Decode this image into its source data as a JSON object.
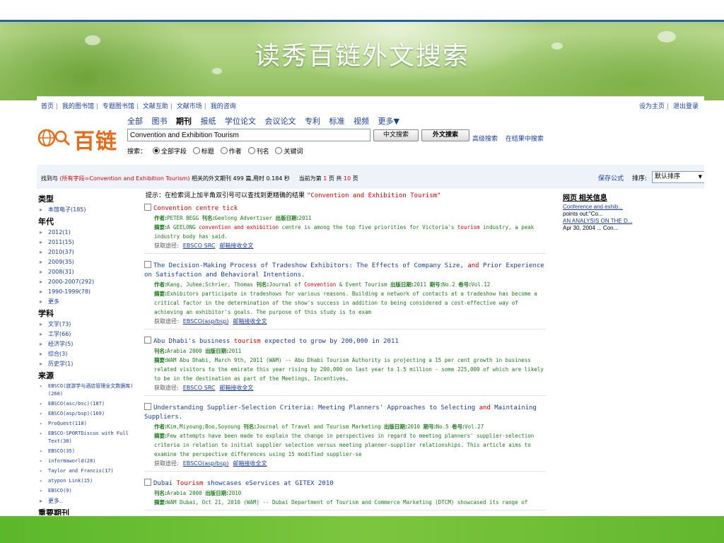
{
  "slide_title": "读秀百链外文搜索",
  "nav": {
    "links": [
      "首页",
      "我的图书馆",
      "专题图书馆",
      "文献互助",
      "文献市场",
      "我的咨询"
    ],
    "right_links": [
      "设为主页",
      "退出登录"
    ]
  },
  "logo_text": "百链",
  "categories": [
    "全部",
    "图书",
    "期刊",
    "报纸",
    "学位论文",
    "会议论文",
    "专利",
    "标准",
    "视频",
    "更多▼"
  ],
  "active_category": "期刊",
  "search": {
    "value": "Convention and Exhibition Tourism",
    "btn_chinese": "中文搜索",
    "btn_foreign": "外文搜索",
    "advanced": "高级搜索",
    "within": "在结果中搜索"
  },
  "scope": {
    "label": "搜索：",
    "options": [
      "全部字段",
      "标题",
      "作者",
      "刊名",
      "关键词"
    ],
    "selected": "全部字段"
  },
  "summary": {
    "prefix": "找到与",
    "query_text": "(所有字段=Convention and Exhibition Tourism)",
    "mid": "相关的外文期刊",
    "count": "499",
    "unit": "篇,用时",
    "time": "0.184",
    "time_unit": "秒",
    "page_label": "当前为第",
    "page": "1",
    "page_mid": "页 共",
    "pages": "10",
    "page_suffix": "页",
    "save_formula": "保存公式",
    "sort_label": "排序:",
    "sort_value": "默认排序"
  },
  "sidebar": {
    "type_header": "类型",
    "types": [
      "本馆电子(185)"
    ],
    "year_header": "年代",
    "years": [
      "2012(1)",
      "2011(15)",
      "2010(37)",
      "2009(35)",
      "2008(31)",
      "2000-2007(292)",
      "1990-1999(78)",
      "更多"
    ],
    "subject_header": "学科",
    "subjects": [
      "文学(73)",
      "工学(66)",
      "经济学(5)",
      "综合(3)",
      "历史学(1)"
    ],
    "source_header": "来源",
    "sources": [
      "EBSCO(旅游学与酒店管理全文数据库)(260)",
      "EBSCO(asc/bsc)(187)",
      "EBSCO(asp/bsp)(169)",
      "ProQuest(110)",
      "EBSCO-SPORTDiscus with Full Text(38)",
      "EBSCO(35)",
      "informaworld(28)",
      "Taylor and Francis(17)",
      "atypon Link(15)",
      "EBSCO(9)",
      "更多.."
    ],
    "journal_header": "重要期刊"
  },
  "hint": {
    "text": "提示：在检索词上加半角双引号可以查找到更精确的结果",
    "query": "\"Convention and Exhibition Tourism\""
  },
  "labels": {
    "author": "作者:",
    "journal": "刊名:",
    "date": "出版日期:",
    "issue": "期号:",
    "volume": "卷号:",
    "abstract": "摘要:",
    "access": "获取途径:",
    "email_delivery": "邮箱接收全文"
  },
  "results": [
    {
      "title": "Convention centre tick",
      "author": "PETER BEGG",
      "journal": "Geelong Advertiser",
      "date": "2011",
      "abstract_pre": "A GEELONG ",
      "abstract_hl1": "convention and exhibition",
      "abstract_mid": " centre is among the top five priorities for Victoria's ",
      "abstract_hl2": "tourism",
      "abstract_post": " industry, a peak industry body has said.",
      "source": "EBSCO SRC"
    },
    {
      "title_pre": "The Decision-Making Process of Tradeshow Exhibitors: The Effects of Company Size, ",
      "title_hl": "and",
      "title_post": " Prior Experience on Satisfaction and Behavioral Intentions.",
      "author": "Kang, Juhee;Schrier, Thomas",
      "journal_pre": "Journal of ",
      "journal_hl": "Convention",
      "journal_post": " & Event Tourism",
      "date": "2011",
      "issue": "No.2",
      "volume": "Vol.12",
      "abstract": "Exhibitors participate in tradeshows for various reasons. Building a network of contacts at a tradeshow has become a critical factor in the determination of the show's success in addition to being considered a cost-effective way of achieving an exhibitor's goals. The purpose of this study is to exam",
      "source": "EBSCO(asp/bsp)"
    },
    {
      "title_pre": "Abu Dhabi's business ",
      "title_hl": "tourism",
      "title_post": " expected to grow by 200,000 in 2011",
      "journal": "Arabia 2000",
      "date": "2011",
      "abstract": "WAM Abu Dhabi, March 9th, 2011 (WAM) -- Abu Dhabi Tourism Authority is projecting a 15 per cent growth in business related visitors to the emirate this year rising by 200,000 on last year to 1.5 million - some 225,000 of which are likely to be in the destination as part of the Meetings, Incentives,",
      "source": "EBSCO SRC"
    },
    {
      "title_pre": "Understanding Supplier-Selection Criteria: Meeting Planners' Approaches to Selecting ",
      "title_hl": "and",
      "title_post": " Maintaining Suppliers.",
      "author": "Kim,Miyoung;Boo,Soyoung",
      "journal": "Journal of Travel and Tourism Marketing",
      "date": "2010",
      "issue": "No.5",
      "volume": "Vol.27",
      "abstract": "Few attempts have been made to explain the change in perspectives in regard to meeting planners' supplier-selection criteria in relation to initial supplier selection versus meeting planner-supplier relationships. This article aims to examine the perspective differences using 15 modified supplier-se",
      "source": "EBSCO(asp/bsp)"
    },
    {
      "title_pre": "Dubai ",
      "title_hl": "Tourism",
      "title_post": " showcases eServices at GITEX 2010",
      "journal": "Arabia 2000",
      "date": "2010",
      "abstract": "WAM Dubai, Oct 21, 2010 (WAM) -- Dubai Department of Tourism and Commerce Marketing (DTCM) showcased its range of"
    }
  ],
  "related": {
    "header": "网页 相关信息",
    "link1": "Conference and exhib...",
    "text1": "points out:\"Co...",
    "link2": "AN ANALYSIS ON THE D...",
    "text2": "Apr 30, 2004 ... Con..."
  }
}
